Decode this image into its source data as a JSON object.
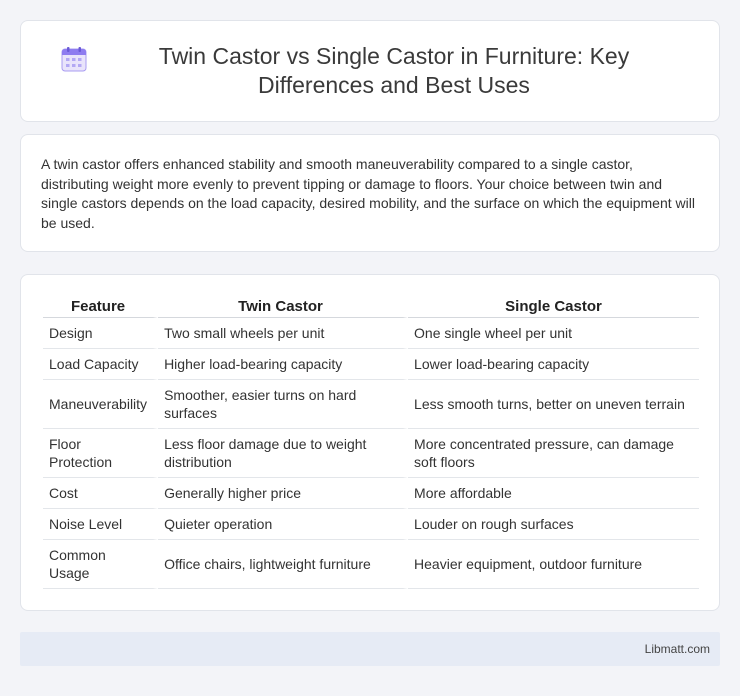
{
  "header": {
    "title": "Twin Castor vs Single Castor in Furniture: Key Differences and Best Uses",
    "icon": "calendar-icon"
  },
  "intro": {
    "text": "A twin castor offers enhanced stability and smooth maneuverability compared to a single castor, distributing weight more evenly to prevent tipping or damage to floors. Your choice between twin and single castors depends on the load capacity, desired mobility, and the surface on which the equipment will be used."
  },
  "table": {
    "headers": [
      "Feature",
      "Twin Castor",
      "Single Castor"
    ],
    "rows": [
      [
        "Design",
        "Two small wheels per unit",
        "One single wheel per unit"
      ],
      [
        "Load Capacity",
        "Higher load-bearing capacity",
        "Lower load-bearing capacity"
      ],
      [
        "Maneuverability",
        "Smoother, easier turns on hard surfaces",
        "Less smooth turns, better on uneven terrain"
      ],
      [
        "Floor Protection",
        "Less floor damage due to weight distribution",
        "More concentrated pressure, can damage soft floors"
      ],
      [
        "Cost",
        "Generally higher price",
        "More affordable"
      ],
      [
        "Noise Level",
        "Quieter operation",
        "Louder on rough surfaces"
      ],
      [
        "Common Usage",
        "Office chairs, lightweight furniture",
        "Heavier equipment, outdoor furniture"
      ]
    ]
  },
  "footer": {
    "text": "Libmatt.com"
  },
  "colors": {
    "background": "#f3f4f8",
    "card": "#ffffff",
    "footer": "#e6ebf5",
    "icon_accent": "#8e7cf0"
  }
}
